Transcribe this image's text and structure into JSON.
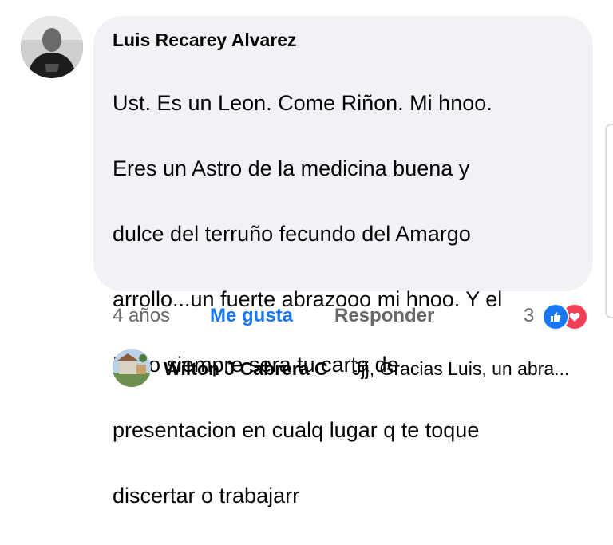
{
  "comment": {
    "author": "Luis Recarey Alvarez",
    "text_lines": [
      "Ust. Es un Leon. Come Riñon. Mi hnoo.",
      "Eres un Astro de la medicina buena y",
      "dulce del terruño fecundo del Amargo",
      "arrollo...un fuerte abrazooo mi hnoo. Y el",
      "Exito siempre sera tu carta de",
      "presentacion en cualq lugar q te toque",
      "discertar o trabajarr"
    ],
    "avatar_icon": "profile-photo"
  },
  "actions": {
    "time": "4 años",
    "like_label": "Me gusta",
    "reply_label": "Responder",
    "reaction_count": "3",
    "reaction_icons": [
      "like-icon",
      "love-icon"
    ]
  },
  "reply": {
    "author": "Wilton J Cabrera C",
    "preview": "Jjj, Gracias Luis, un abra...",
    "avatar_icon": "profile-photo"
  },
  "colors": {
    "bubble": "#f0f2f5",
    "link_blue": "#1877f2",
    "muted": "#65676b",
    "love": "#f33e58"
  }
}
